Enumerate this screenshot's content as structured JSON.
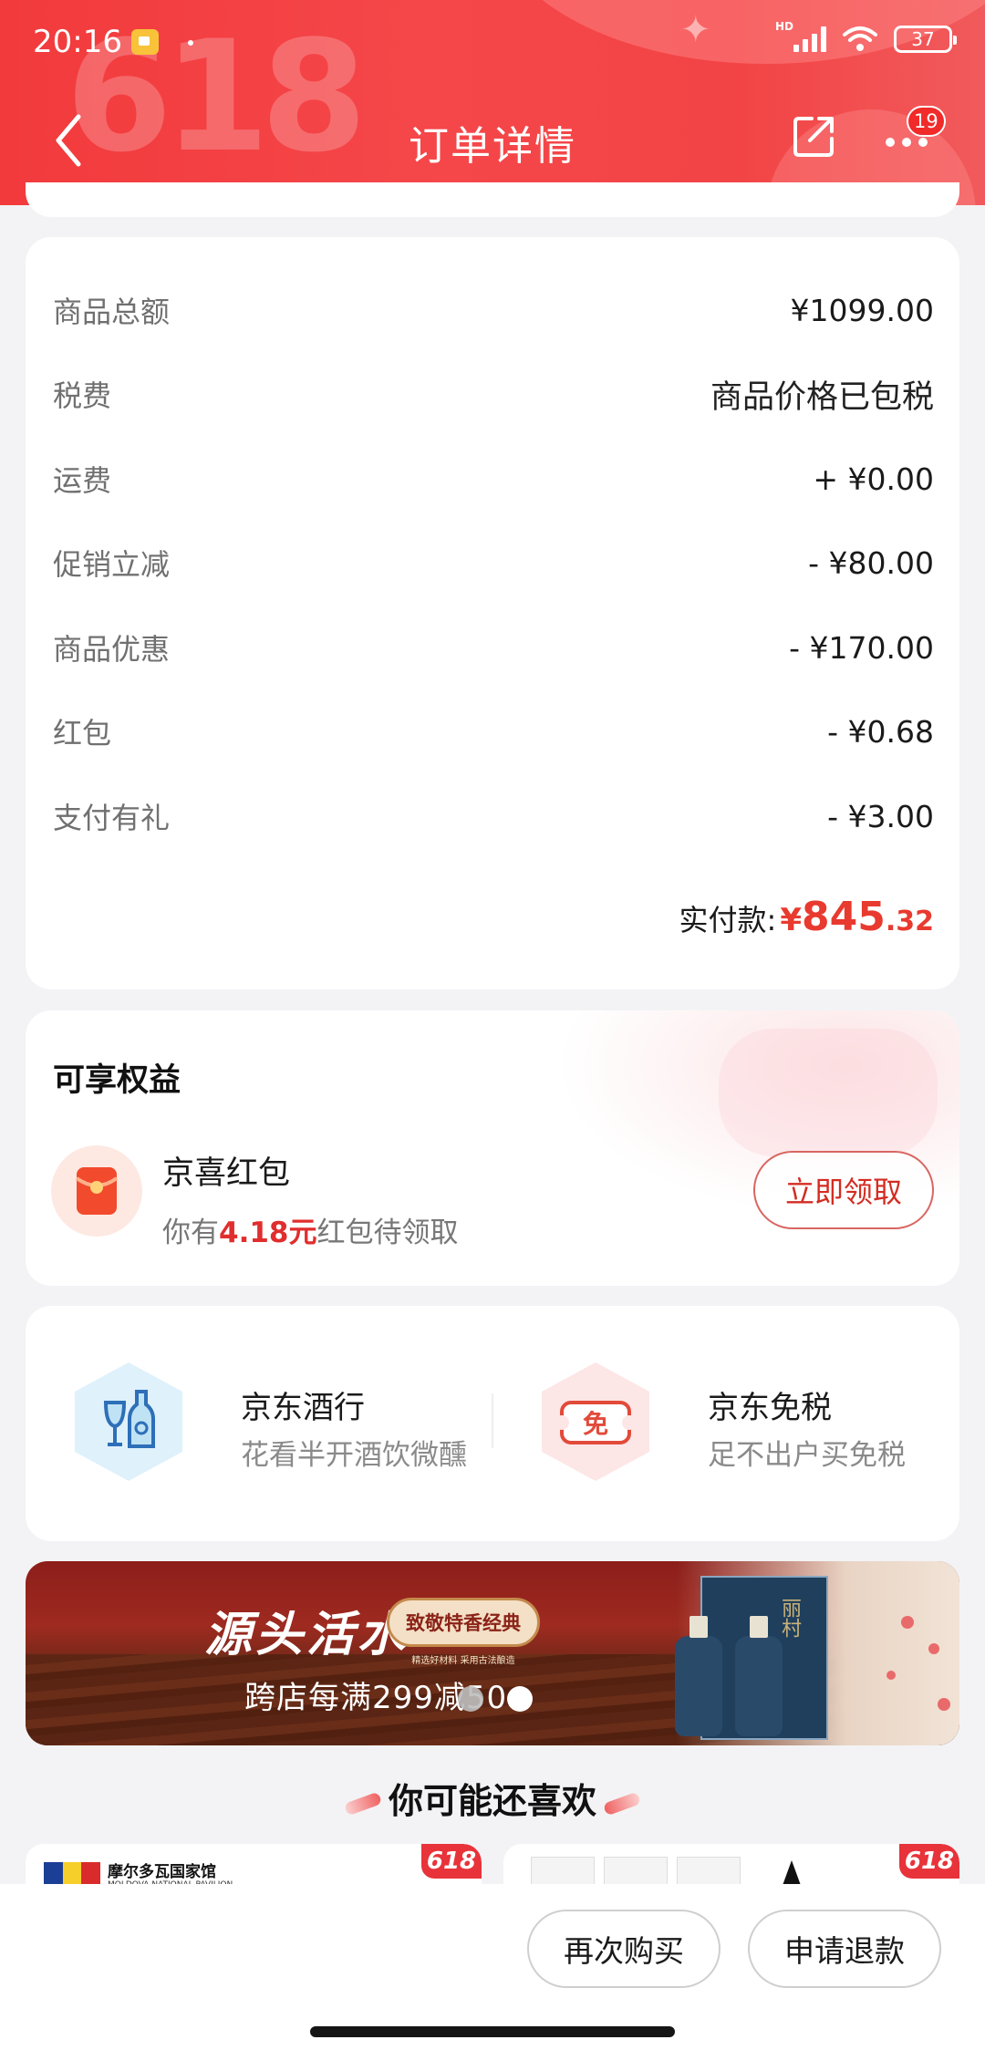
{
  "status_bar": {
    "time": "20:16",
    "network": "HD",
    "battery": "37"
  },
  "header": {
    "title": "订单详情",
    "decoration_text": "618",
    "more_badge": "19",
    "accent_color": "#f23a3c"
  },
  "price_breakdown": {
    "rows": [
      {
        "label": "商品总额",
        "value": "¥1099.00"
      },
      {
        "label": "税费",
        "value": "商品价格已包税"
      },
      {
        "label": "运费",
        "value": "+ ¥0.00"
      },
      {
        "label": "促销立减",
        "value": "- ¥80.00"
      },
      {
        "label": "商品优惠",
        "value": "- ¥170.00"
      },
      {
        "label": "红包",
        "value": "- ¥0.68"
      },
      {
        "label": "支付有礼",
        "value": "- ¥3.00"
      }
    ],
    "total_label": "实付款:",
    "total_currency": "¥",
    "total_integer": "845",
    "total_decimal": ".32",
    "total_color": "#e83a2f"
  },
  "benefits": {
    "title": "可享权益",
    "item_name": "京喜红包",
    "desc_prefix": "你有",
    "desc_amount": "4.18元",
    "desc_suffix": "红包待领取",
    "claim_button": "立即领取"
  },
  "services": [
    {
      "name": "京东酒行",
      "desc": "花看半开酒饮微醺",
      "icon": "wine-icon"
    },
    {
      "name": "京东免税",
      "desc": "足不出户买免税",
      "icon": "duty-free-icon"
    }
  ],
  "banner": {
    "title": "源头活水",
    "pill": "致敬特香经典",
    "pill_sub": "精选好材料 采用古法酿造",
    "promo": "跨店每满299减50",
    "product_label": "丽村",
    "slide_count": 2,
    "active_slide": 2
  },
  "recommend": {
    "title": "你可能还喜欢",
    "products": [
      {
        "tag": "618",
        "label": "摩尔多瓦国家馆",
        "sub": "MOLDOVA NATIONAL PAVILION"
      },
      {
        "tag": "618"
      }
    ]
  },
  "actions": {
    "rebuy": "再次购买",
    "refund": "申请退款"
  }
}
